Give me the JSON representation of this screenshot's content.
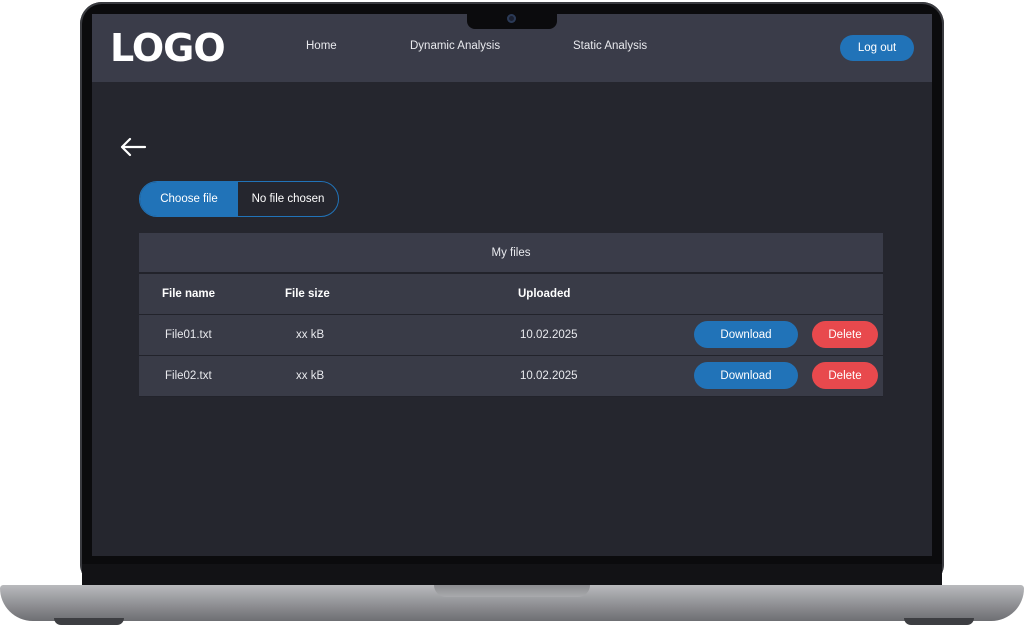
{
  "nav": {
    "logo": "LOGO",
    "links": [
      "Home",
      "Dynamic Analysis",
      "Static Analysis"
    ],
    "logout_label": "Log out"
  },
  "upload": {
    "choose_label": "Choose file",
    "status": "No file chosen"
  },
  "files": {
    "title": "My files",
    "headers": [
      "File name",
      "File size",
      "Uploaded"
    ],
    "rows": [
      {
        "name": "File01.txt",
        "size": "xx kB",
        "uploaded": "10.02.2025",
        "download_label": "Download",
        "delete_label": "Delete"
      },
      {
        "name": "File02.txt",
        "size": "xx kB",
        "uploaded": "10.02.2025",
        "download_label": "Download",
        "delete_label": "Delete"
      }
    ]
  },
  "colors": {
    "accent": "#2173b8",
    "danger": "#e8494d",
    "background": "#25262e",
    "panel": "#3a3c49"
  },
  "icons": {
    "back": "arrow-left-icon",
    "camera": "camera-icon"
  }
}
